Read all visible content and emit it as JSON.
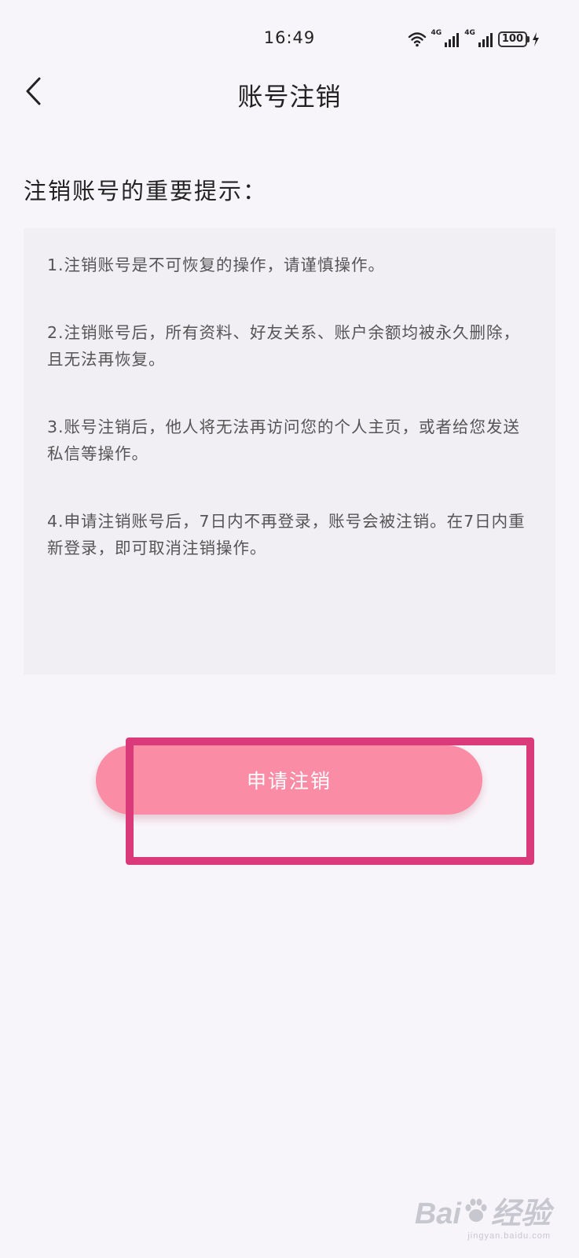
{
  "status_bar": {
    "time": "16:49",
    "network_1": "4G",
    "network_2": "4G",
    "battery": "100"
  },
  "header": {
    "title": "账号注销",
    "back_icon": "chevron-left-icon"
  },
  "content": {
    "heading": "注销账号的重要提示：",
    "tips": [
      "1.注销账号是不可恢复的操作，请谨慎操作。",
      "2.注销账号后，所有资料、好友关系、账户余额均被永久删除，且无法再恢复。",
      "3.账号注销后，他人将无法再访问您的个人主页，或者给您发送私信等操作。",
      "4.申请注销账号后，7日内不再登录，账号会被注销。在7日内重新登录，即可取消注销操作。"
    ]
  },
  "action": {
    "apply_label": "申请注销",
    "button_color": "#fb8ca6"
  },
  "annotation": {
    "highlight_color": "#db3a7a"
  },
  "watermark": {
    "brand": "Bai",
    "brand_tail": "经验",
    "url": "jingyan.baidu.com"
  }
}
